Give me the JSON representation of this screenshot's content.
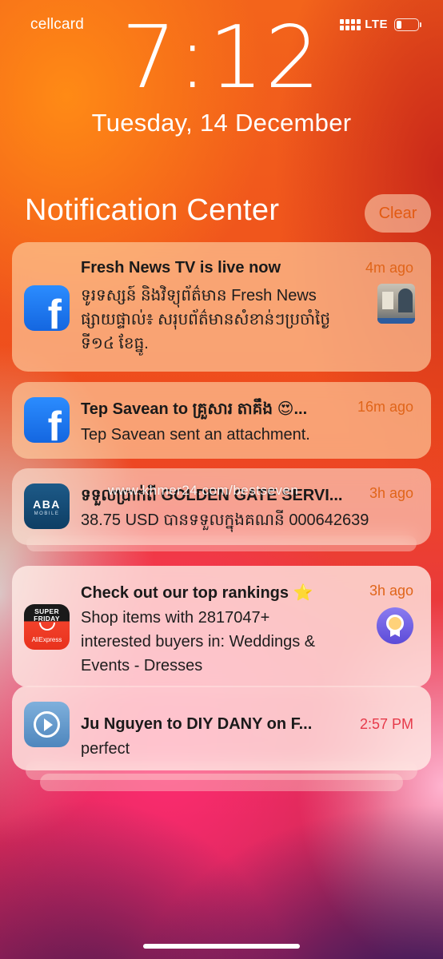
{
  "status_bar": {
    "carrier": "cellcard",
    "network": "LTE",
    "battery_level": 0.25
  },
  "lock_screen": {
    "time": "7:12",
    "date": "Tuesday, 14 December"
  },
  "notification_center": {
    "title": "Notification Center",
    "clear_label": "Clear"
  },
  "notifications": [
    {
      "app_icon": "facebook-icon",
      "title": "Fresh News TV is live now",
      "time": "4m ago",
      "body_lines": [
        "ទូរទស្សន៍ និងវិទ្យុព័ត៌មាន Fresh News",
        "ផ្សាយផ្ទាល់៖ សរុបព័ត៌មានសំខាន់ៗប្រចាំថ្ងៃ",
        "ទី១៤ ខែធ្នូ."
      ]
    },
    {
      "app_icon": "facebook-icon",
      "title": "Tep Savean to គ្រួសារ តាគឹង 😍...",
      "time": "16m ago",
      "body_lines": [
        "Tep Savean sent an attachment."
      ]
    },
    {
      "app_icon": "aba-mobile-icon",
      "icon_text": {
        "brand": "ABA",
        "sub": "MOBILE"
      },
      "title": "ទទួលប្រាក់ពី GOLDEN GATE SERVI...",
      "time": "3h ago",
      "body_lines": [
        "38.75 USD បានទទួលក្នុងគណនី 000642639"
      ]
    },
    {
      "app_icon": "aliexpress-icon",
      "icon_text": {
        "line1": "SUPER",
        "line2": "FRIDAY",
        "brand": "AliExpress"
      },
      "title": "Check out our top rankings ⭐",
      "time": "3h ago",
      "body_lines": [
        "Shop items with 2817047+",
        "interested buyers in: Weddings &",
        "Events - Dresses"
      ]
    },
    {
      "app_icon": "zalo-icon",
      "title": "Ju Nguyen to DIY DANY on F...",
      "time": "2:57 PM",
      "body_lines": [
        "perfect"
      ]
    }
  ],
  "watermark": "www.khmer24.com/bestseven",
  "colors": {
    "accent": "#e0651a",
    "time_red": "#e63a4a",
    "facebook": "#1877f2"
  }
}
